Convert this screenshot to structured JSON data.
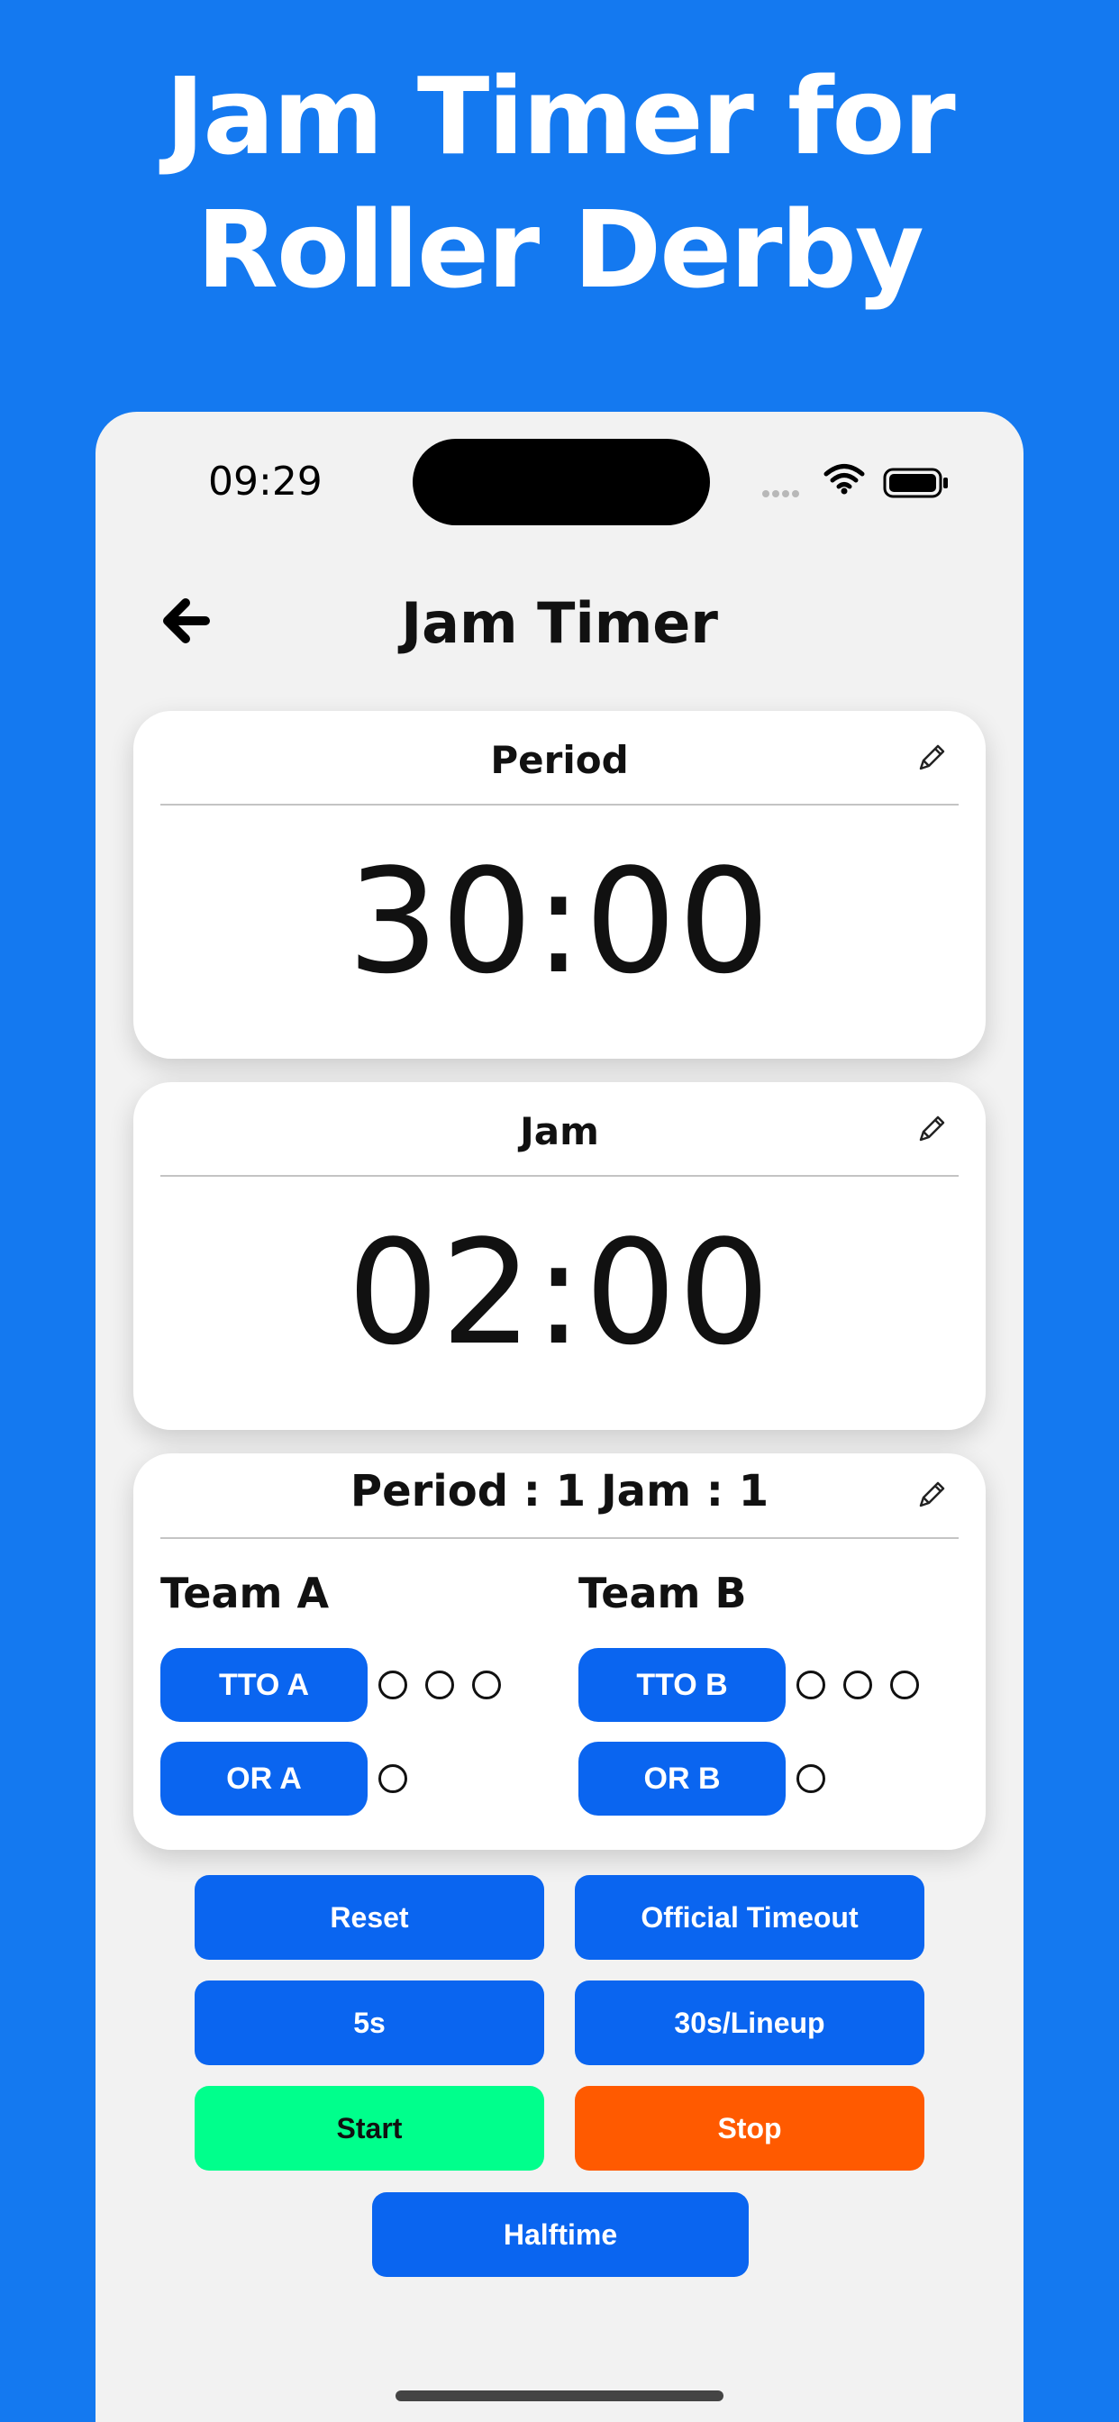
{
  "headline": {
    "line1": "Jam Timer for",
    "line2": "Roller Derby"
  },
  "status_bar": {
    "time": "09:29"
  },
  "nav": {
    "title": "Jam Timer"
  },
  "period_card": {
    "label": "Period",
    "time": "30:00"
  },
  "jam_card": {
    "label": "Jam",
    "time": "02:00"
  },
  "game_card": {
    "counter": "Period : 1   Jam : 1",
    "team_a": {
      "name": "Team A",
      "tto_label": "TTO A",
      "tto_count": 3,
      "or_label": "OR A",
      "or_count": 1
    },
    "team_b": {
      "name": "Team B",
      "tto_label": "TTO B",
      "tto_count": 3,
      "or_label": "OR B",
      "or_count": 1
    }
  },
  "controls": {
    "reset": "Reset",
    "official_timeout": "Official Timeout",
    "five_s": "5s",
    "lineup": "30s/Lineup",
    "start": "Start",
    "stop": "Stop",
    "halftime": "Halftime"
  },
  "colors": {
    "background": "#1479f0",
    "button": "#0a65f0",
    "start": "#00ff8c",
    "stop": "#ff5a00"
  }
}
